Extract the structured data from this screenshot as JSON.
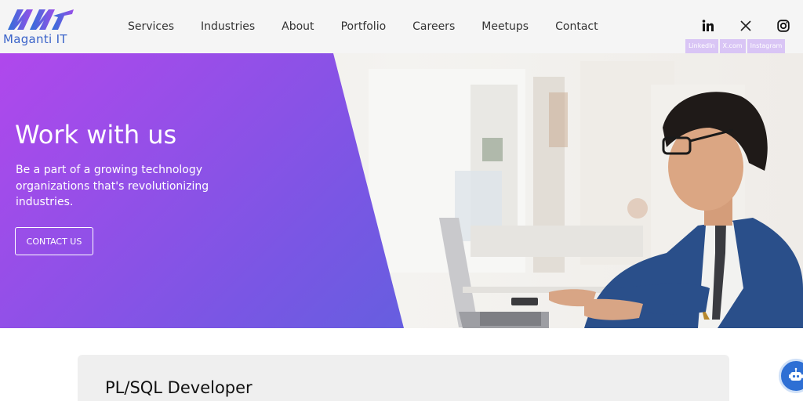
{
  "brand": {
    "name": "Maganti IT",
    "primary_color": "#3a63c9",
    "accent_color": "#b048ec"
  },
  "nav": {
    "items": [
      "Services",
      "Industries",
      "About",
      "Portfolio",
      "Careers",
      "Meetups",
      "Contact"
    ]
  },
  "social": {
    "icons": [
      "linkedin-icon",
      "x-icon",
      "instagram-icon"
    ],
    "labels": [
      "LinkedIn",
      "X.com",
      "Instagram"
    ]
  },
  "hero": {
    "title": "Work with us",
    "subtitle": "Be a part of a growing technology organizations that's revolutionizing industries.",
    "button_label": "CONTACT US",
    "gradient_colors": [
      "#b048ec",
      "#7a56e4",
      "#3d6fd6"
    ]
  },
  "job": {
    "title": "PL/SQL Developer"
  },
  "chatbot": {
    "icon": "chatbot-icon",
    "color": "#2e6fd4"
  }
}
